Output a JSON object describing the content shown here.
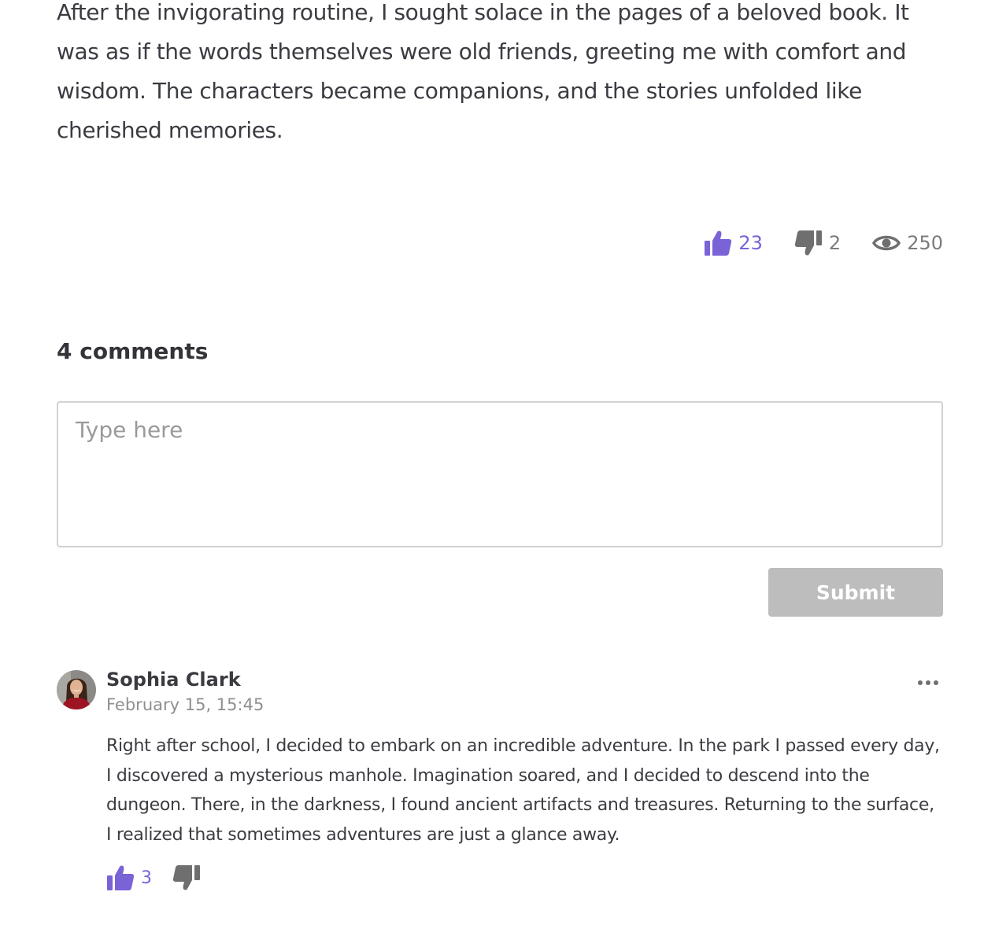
{
  "article": {
    "paragraph": "After the invigorating routine, I sought solace in the pages of a beloved book. It was as if the words themselves were old friends, greeting me with comfort and wisdom. The characters became companions, and the stories unfolded like cherished memories."
  },
  "stats": {
    "likes": "23",
    "dislikes": "2",
    "views": "250"
  },
  "comments_section": {
    "count_label": "4 comments",
    "input_placeholder": "Type here",
    "submit_label": "Submit"
  },
  "comments": [
    {
      "author": "Sophia Clark",
      "date": "February 15, 15:45",
      "text": "Right after school, I decided to embark on an incredible adventure. In the park I passed every day, I discovered a mysterious manhole. Imagination soared, and I decided to descend into the dungeon. There, in the darkness, I found ancient artifacts and treasures. Returning to the surface, I realized that sometimes adventures are just a glance away.",
      "likes": "3"
    }
  ],
  "icons": {
    "like": "thumbs-up-icon",
    "dislike": "thumbs-down-icon",
    "views": "eye-icon",
    "more": "more-dots-icon"
  },
  "colors": {
    "accent": "#7a62d7",
    "muted": "#7b7b7b",
    "submit_disabled": "#bdbdbd"
  }
}
